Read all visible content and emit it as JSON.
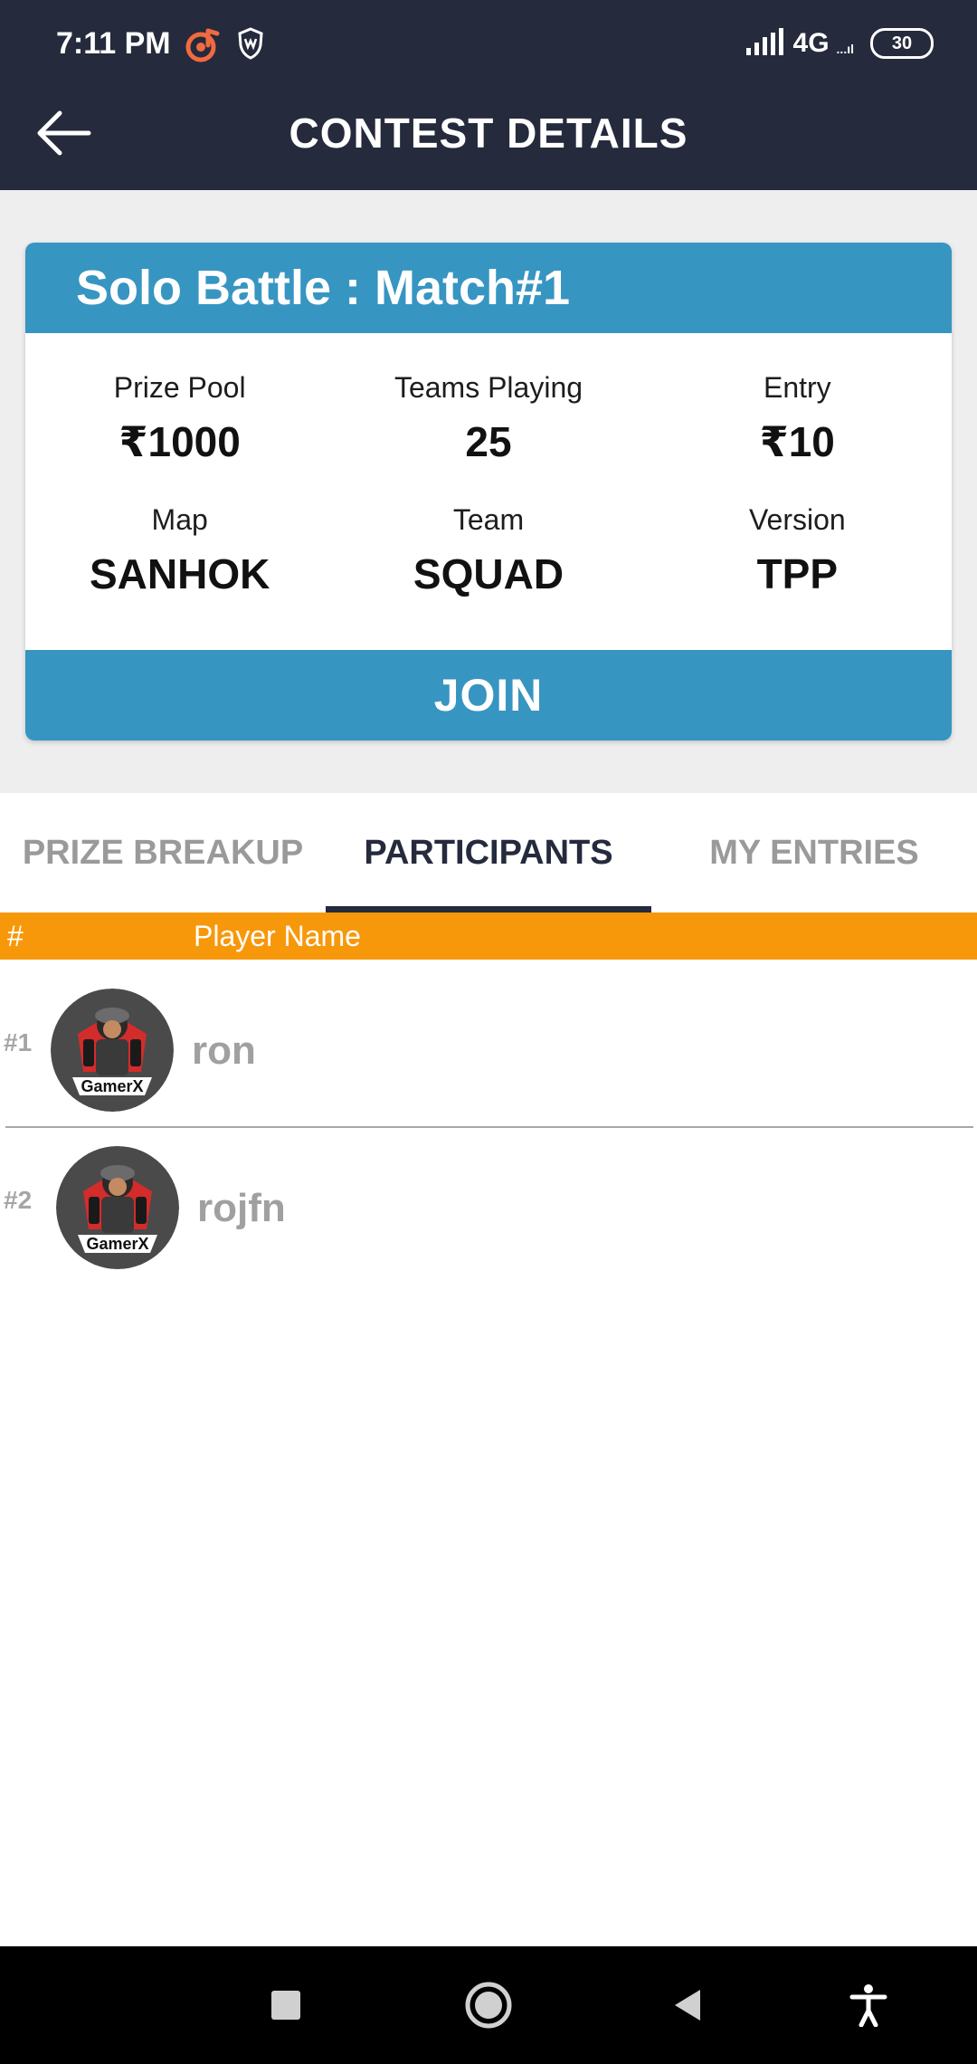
{
  "status_bar": {
    "time": "7:11 PM",
    "network": "4G",
    "network_sub": "...ıl",
    "battery": "30",
    "icons": [
      "music-app-icon",
      "shield-app-icon",
      "signal-icon",
      "battery-icon"
    ]
  },
  "app_bar": {
    "title": "CONTEST DETAILS",
    "back_icon": "arrow-left-icon"
  },
  "contest": {
    "title": "Solo Battle : Match#1",
    "details": [
      {
        "label": "Prize Pool",
        "value": "₹1000"
      },
      {
        "label": "Teams Playing",
        "value": "25"
      },
      {
        "label": "Entry",
        "value": "₹10"
      },
      {
        "label": "Map",
        "value": "SANHOK"
      },
      {
        "label": "Team",
        "value": "SQUAD"
      },
      {
        "label": "Version",
        "value": "TPP"
      }
    ],
    "join_label": "JOIN"
  },
  "tabs": [
    {
      "label": "PRIZE BREAKUP",
      "active": false
    },
    {
      "label": "PARTICIPANTS",
      "active": true
    },
    {
      "label": "MY ENTRIES",
      "active": false
    }
  ],
  "participants": {
    "headers": {
      "rank": "#",
      "name": "Player Name"
    },
    "rows": [
      {
        "rank": "#1",
        "name": "ron",
        "avatar_text": "GamerX"
      },
      {
        "rank": "#2",
        "name": "rojfn",
        "avatar_text": "GamerX"
      }
    ]
  },
  "nav_bar": {
    "icons": [
      "recents-square-icon",
      "home-circle-icon",
      "back-triangle-icon",
      "accessibility-icon"
    ]
  },
  "colors": {
    "header_bg": "#252a3d",
    "accent_blue": "#3795c1",
    "table_header_orange": "#f7980b",
    "page_gray": "#eeeeee"
  }
}
